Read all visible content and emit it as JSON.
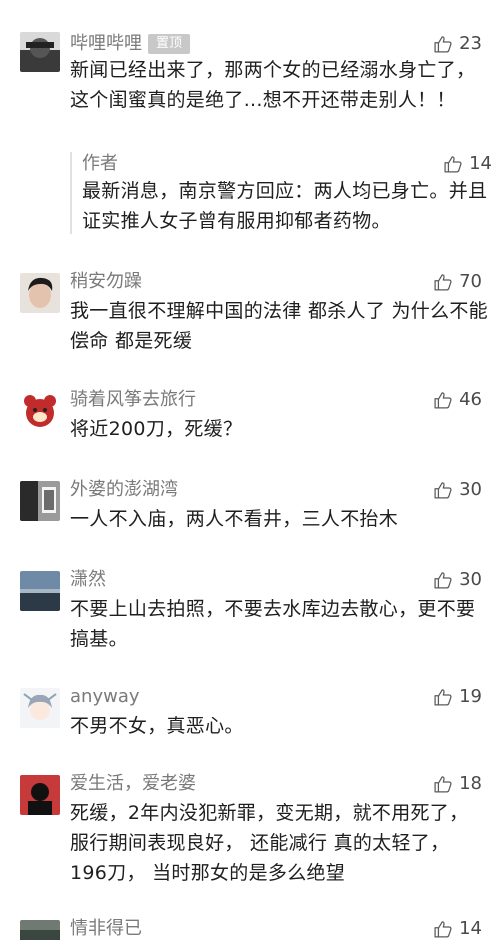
{
  "comments": [
    {
      "username": "哔哩哔哩",
      "badge": "置顶",
      "likes": "23",
      "text": "新闻已经出来了，那两个女的已经溺水身亡了，这个闺蜜真的是绝了...想不开还带走别人！！",
      "reply": {
        "username": "作者",
        "likes": "14",
        "text": "最新消息，南京警方回应：两人均已身亡。并且证实推人女子曾有服用抑郁者药物。"
      }
    },
    {
      "username": "稍安勿躁",
      "likes": "70",
      "text": "我一直很不理解中国的法律  都杀人了 为什么不能偿命  都是死缓"
    },
    {
      "username": "骑着风筝去旅行",
      "likes": "46",
      "text": "将近200刀，死缓？"
    },
    {
      "username": "外婆的澎湖湾",
      "likes": "30",
      "text": "一人不入庙，两人不看井，三人不抬木"
    },
    {
      "username": "潇然",
      "likes": "30",
      "text": "不要上山去拍照，不要去水库边去散心，更不要搞基。"
    },
    {
      "username": "anyway",
      "likes": "19",
      "text": "不男不女，真恶心。"
    },
    {
      "username": "爱生活，爱老婆",
      "likes": "18",
      "text": "死缓，2年内没犯新罪，变无期，就不用死了，  服行期间表现良好，  还能减行   真的太轻了，  196刀，  当时那女的是多么绝望"
    },
    {
      "username": "情非得已",
      "likes": "14",
      "text": ""
    }
  ]
}
